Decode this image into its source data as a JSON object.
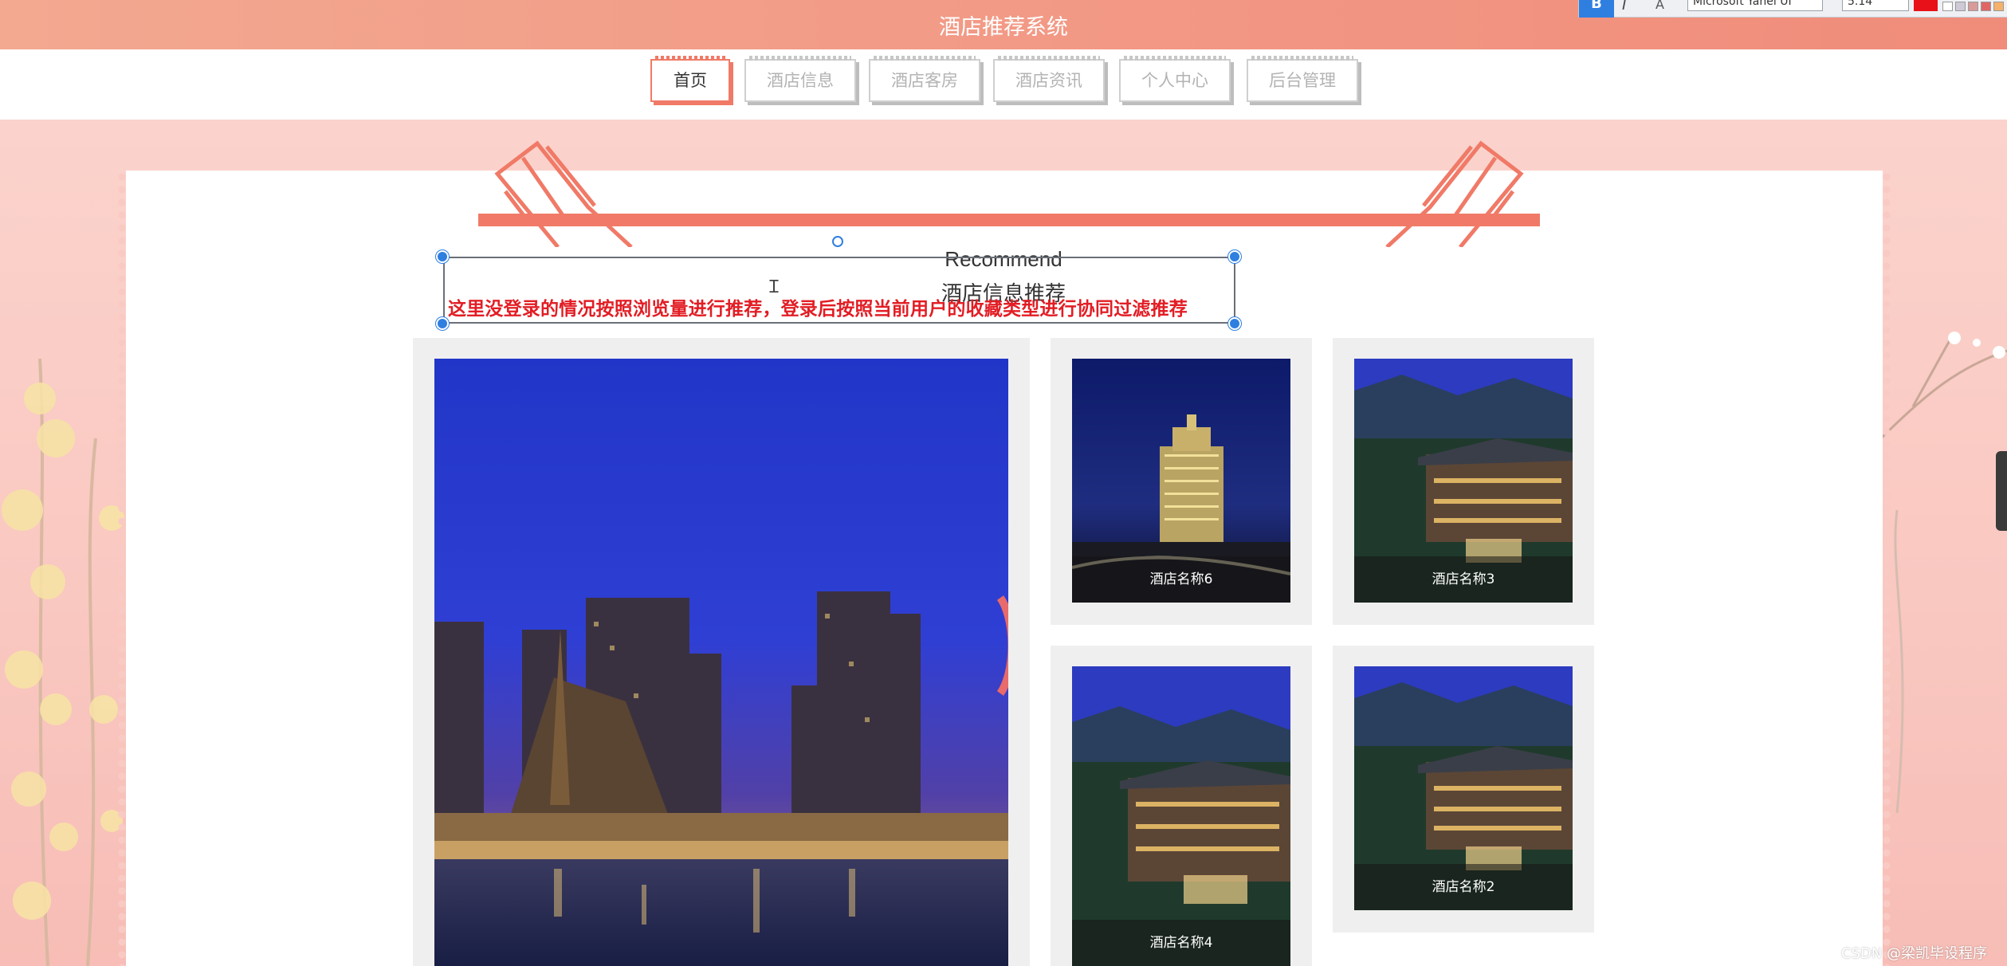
{
  "site": {
    "title": "酒店推荐系统"
  },
  "editor_toolbar": {
    "bold_label": "B",
    "italic_label": "I",
    "clear_label": "A",
    "font_family": "Microsoft Yahei UI",
    "font_size": "5.14",
    "accent_color": "#2f7fe0",
    "text_color": "#e8111a"
  },
  "nav": {
    "items": [
      {
        "label": "首页",
        "active": true
      },
      {
        "label": "酒店信息",
        "active": false
      },
      {
        "label": "酒店客房",
        "active": false
      },
      {
        "label": "酒店资讯",
        "active": false
      },
      {
        "label": "个人中心",
        "active": false
      },
      {
        "label": "后台管理",
        "active": false
      }
    ],
    "accent_color": "#f07a67"
  },
  "recommend": {
    "title_en": "Recommend",
    "title_cn": "酒店信息推荐",
    "annotation": "这里没登录的情况按照浏览量进行推荐，登录后按照当前用户的收藏类型进行协同过滤推荐"
  },
  "hotels": [
    {
      "name": "",
      "image": "night-city-riverfront-photo",
      "featured": true
    },
    {
      "name": "酒店名称6",
      "image": "night-hotel-tower-photo"
    },
    {
      "name": "酒店名称3",
      "image": "mountain-resort-photo"
    },
    {
      "name": "酒店名称4",
      "image": "mountain-resort-photo"
    },
    {
      "name": "酒店名称2",
      "image": "mountain-resort-photo"
    }
  ],
  "watermark": "CSDN @梁凯毕设程序"
}
